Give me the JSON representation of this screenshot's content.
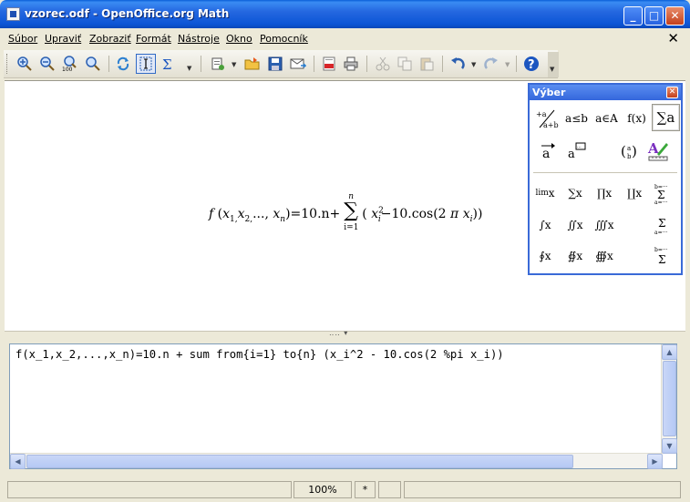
{
  "window": {
    "title": "vzorec.odf - OpenOffice.org Math",
    "minimize": "_",
    "maximize": "□",
    "close": "✕"
  },
  "menu": {
    "items": [
      "Súbor",
      "Upraviť",
      "Zobraziť",
      "Formát",
      "Nástroje",
      "Okno",
      "Pomocník"
    ],
    "close": "✕"
  },
  "toolbar": {
    "icons": [
      "zoom-in-icon",
      "zoom-out-icon",
      "zoom-100-icon",
      "zoom-fit-icon",
      "refresh-icon",
      "formula-cursor-icon",
      "selection-sigma-icon",
      "new-icon",
      "open-folder-icon",
      "save-icon",
      "email-icon",
      "export-pdf-icon",
      "print-icon",
      "cut-icon",
      "copy-icon",
      "paste-icon",
      "undo-icon",
      "redo-icon",
      "help-icon"
    ],
    "zoom100_label": "100"
  },
  "formula": {
    "lhs_f": "f",
    "lhs_open": "(",
    "x": "x",
    "s1": "1,",
    "s2": "2,",
    "dots": "...,",
    "sn": "n",
    "lhs_close": ")",
    "eq": "=10.n+",
    "sum_upper": "n",
    "sum_sigma": "∑",
    "sum_lower": "i=1",
    "term_open": "(",
    "si": "i",
    "sq": "2",
    "minus": "−10.cos",
    "cos_open": "(2",
    "pi": "π",
    "term_close": "))"
  },
  "splitter": {
    "grip": "‥‥ ▾"
  },
  "editor": {
    "text": "f(x_1,x_2,...,x_n)=10.n + sum from{i=1} to{n} (x_i^2 - 10.cos(2 %pi x_i))",
    "scroll_up": "▲",
    "scroll_down": "▼",
    "scroll_left": "◀",
    "scroll_right": "▶"
  },
  "statusbar": {
    "zoom": "100%",
    "modified": "*"
  },
  "selection_window": {
    "title": "Výber",
    "close": "✕",
    "categories": [
      "+a/a+b",
      "a≤b",
      "a∈A",
      "f(x)",
      "∑a",
      "a⃗",
      "a💬",
      "(a/b)",
      "A✎"
    ],
    "symbols": [
      "lim x",
      "∑x",
      "∏x",
      "∐x",
      "b∑a",
      "∫x",
      "∬x",
      "∭x",
      "b∑a=",
      "∮x",
      "∯x",
      "∰x",
      "b∑"
    ]
  }
}
